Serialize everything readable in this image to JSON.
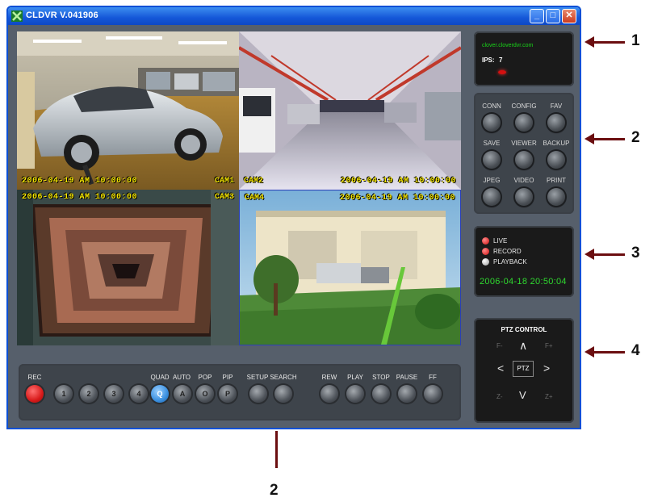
{
  "window": {
    "title": "CLDVR V.041906",
    "minimize_glyph": "_",
    "maximize_glyph": "□",
    "close_glyph": "✕"
  },
  "cameras": [
    {
      "name": "CAM1",
      "timestamp": "2006-04-19 AM 10:00:00"
    },
    {
      "name": "CAM2",
      "timestamp": "2006-04-19 AM 10:00:00"
    },
    {
      "name": "CAM3",
      "timestamp": "2006-04-19 AM 10:00:00"
    },
    {
      "name": "CAM4",
      "timestamp": "2006-04-19 AM 10:00:00"
    }
  ],
  "info_panel": {
    "url": "clover.cloverdvr.com",
    "ips_label": "IPS:",
    "ips_value": "7"
  },
  "function_buttons": [
    "CONN",
    "CONFIG",
    "FAV",
    "SAVE",
    "VIEWER",
    "BACKUP",
    "JPEG",
    "VIDEO",
    "PRINT"
  ],
  "status_panel": {
    "items": [
      "LIVE",
      "RECORD",
      "PLAYBACK"
    ],
    "datetime": "2006-04-18 20:50:04"
  },
  "ptz": {
    "title": "PTZ CONTROL",
    "focus_minus": "F-",
    "focus_plus": "F+",
    "zoom_minus": "Z-",
    "zoom_plus": "Z+",
    "center": "PTZ",
    "up": "∧",
    "down": "V",
    "left": "<",
    "right": ">"
  },
  "control_bar": {
    "rec": {
      "label": "REC"
    },
    "channels": [
      {
        "label": "",
        "glyph": "1"
      },
      {
        "label": "",
        "glyph": "2"
      },
      {
        "label": "",
        "glyph": "3"
      },
      {
        "label": "",
        "glyph": "4"
      }
    ],
    "modes": [
      {
        "label": "QUAD",
        "glyph": "Q"
      },
      {
        "label": "AUTO",
        "glyph": "A"
      },
      {
        "label": "POP",
        "glyph": "O"
      },
      {
        "label": "PIP",
        "glyph": "P"
      }
    ],
    "setup": {
      "label": "SETUP"
    },
    "search": {
      "label": "SEARCH"
    },
    "playback": [
      {
        "label": "REW"
      },
      {
        "label": "PLAY"
      },
      {
        "label": "STOP"
      },
      {
        "label": "PAUSE"
      },
      {
        "label": "FF"
      }
    ]
  },
  "callouts": [
    "1",
    "2",
    "3",
    "4",
    "2"
  ],
  "colors": {
    "title_bar": "#1457d8",
    "timestamp_overlay": "#f5e600",
    "url_text": "#19d419",
    "datetime_text": "#2fd82f",
    "arrow": "#6b0e10",
    "rec_button": "#d81a1a",
    "quad_button": "#3a8fe0"
  }
}
